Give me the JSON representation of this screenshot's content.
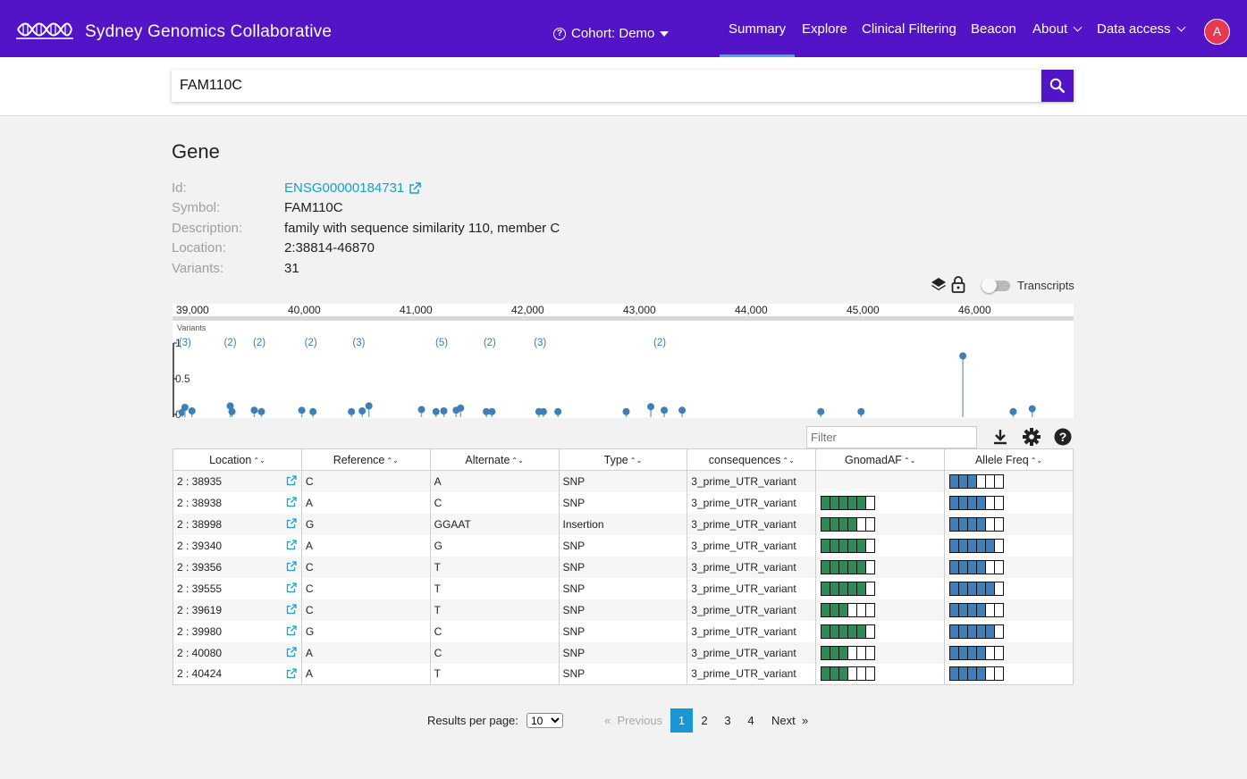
{
  "header": {
    "brand": "Sydney Genomics Collaborative",
    "cohort": "Cohort: Demo",
    "nav": [
      {
        "label": "Summary",
        "active": true
      },
      {
        "label": "Explore"
      },
      {
        "label": "Clinical Filtering"
      },
      {
        "label": "Beacon"
      },
      {
        "label": "About",
        "dropdown": true
      },
      {
        "label": "Data access",
        "dropdown": true
      }
    ],
    "avatar_letter": "A",
    "bg_color": "#5314c8"
  },
  "search": {
    "value": "FAM110C",
    "icon": "search-icon"
  },
  "gene": {
    "title": "Gene",
    "fields": [
      {
        "label": "Id:",
        "value": "ENSG00000184731",
        "link": true
      },
      {
        "label": "Symbol:",
        "value": "FAM110C"
      },
      {
        "label": "Description:",
        "value": "family with sequence similarity 110, member C"
      },
      {
        "label": "Location:",
        "value": "2:38814-46870"
      },
      {
        "label": "Variants:",
        "value": "31"
      }
    ]
  },
  "track": {
    "transcripts_label": "Transcripts",
    "transcripts_on": false,
    "panel_label": "Variants",
    "axis_ticks": [
      "39,000",
      "40,000",
      "41,000",
      "42,000",
      "43,000",
      "44,000",
      "45,000",
      "46,000"
    ],
    "y_ticks": [
      "1",
      "0.5",
      "0"
    ],
    "clusters": [
      {
        "label": "(3)",
        "pos": 38935
      },
      {
        "label": "(2)",
        "pos": 39340
      },
      {
        "label": "(2)",
        "pos": 39600
      },
      {
        "label": "(2)",
        "pos": 40060
      },
      {
        "label": "(3)",
        "pos": 40490
      },
      {
        "label": "(5)",
        "pos": 41230
      },
      {
        "label": "(2)",
        "pos": 41660
      },
      {
        "label": "(3)",
        "pos": 42110
      },
      {
        "label": "(2)",
        "pos": 43180
      }
    ],
    "lollipops": [
      {
        "pos": 38910,
        "af": 0.03
      },
      {
        "pos": 38935,
        "af": 0.1
      },
      {
        "pos": 38998,
        "af": 0.05
      },
      {
        "pos": 39340,
        "af": 0.12
      },
      {
        "pos": 39356,
        "af": 0.04
      },
      {
        "pos": 39555,
        "af": 0.06
      },
      {
        "pos": 39619,
        "af": 0.04
      },
      {
        "pos": 39980,
        "af": 0.06
      },
      {
        "pos": 40080,
        "af": 0.04
      },
      {
        "pos": 40424,
        "af": 0.04
      },
      {
        "pos": 40520,
        "af": 0.05
      },
      {
        "pos": 40580,
        "af": 0.12
      },
      {
        "pos": 41050,
        "af": 0.07
      },
      {
        "pos": 41180,
        "af": 0.04
      },
      {
        "pos": 41250,
        "af": 0.05
      },
      {
        "pos": 41360,
        "af": 0.06
      },
      {
        "pos": 41400,
        "af": 0.09
      },
      {
        "pos": 41630,
        "af": 0.04
      },
      {
        "pos": 41680,
        "af": 0.04
      },
      {
        "pos": 42100,
        "af": 0.04
      },
      {
        "pos": 42140,
        "af": 0.04
      },
      {
        "pos": 42270,
        "af": 0.04
      },
      {
        "pos": 42880,
        "af": 0.04
      },
      {
        "pos": 43100,
        "af": 0.11
      },
      {
        "pos": 43220,
        "af": 0.06
      },
      {
        "pos": 43380,
        "af": 0.06
      },
      {
        "pos": 44620,
        "af": 0.04
      },
      {
        "pos": 44980,
        "af": 0.04
      },
      {
        "pos": 45890,
        "af": 0.82
      },
      {
        "pos": 46340,
        "af": 0.04
      },
      {
        "pos": 46510,
        "af": 0.08
      }
    ]
  },
  "table": {
    "filter_placeholder": "Filter",
    "columns": [
      "Location",
      "Reference",
      "Alternate",
      "Type",
      "consequences",
      "GnomadAF",
      "Allele Freq"
    ],
    "rows": [
      {
        "location": "2 : 38935",
        "ref": "C",
        "alt": "A",
        "type": "SNP",
        "consequence": "3_prime_UTR_variant",
        "gnomad": 0,
        "allele": 3
      },
      {
        "location": "2 : 38938",
        "ref": "A",
        "alt": "C",
        "type": "SNP",
        "consequence": "3_prime_UTR_variant",
        "gnomad": 5,
        "allele": 4
      },
      {
        "location": "2 : 38998",
        "ref": "G",
        "alt": "GGAAT",
        "type": "Insertion",
        "consequence": "3_prime_UTR_variant",
        "gnomad": 4,
        "allele": 4
      },
      {
        "location": "2 : 39340",
        "ref": "A",
        "alt": "G",
        "type": "SNP",
        "consequence": "3_prime_UTR_variant",
        "gnomad": 5,
        "allele": 5
      },
      {
        "location": "2 : 39356",
        "ref": "C",
        "alt": "T",
        "type": "SNP",
        "consequence": "3_prime_UTR_variant",
        "gnomad": 5,
        "allele": 4
      },
      {
        "location": "2 : 39555",
        "ref": "C",
        "alt": "T",
        "type": "SNP",
        "consequence": "3_prime_UTR_variant",
        "gnomad": 5,
        "allele": 5
      },
      {
        "location": "2 : 39619",
        "ref": "C",
        "alt": "T",
        "type": "SNP",
        "consequence": "3_prime_UTR_variant",
        "gnomad": 3,
        "allele": 4
      },
      {
        "location": "2 : 39980",
        "ref": "G",
        "alt": "C",
        "type": "SNP",
        "consequence": "3_prime_UTR_variant",
        "gnomad": 5,
        "allele": 5
      },
      {
        "location": "2 : 40080",
        "ref": "A",
        "alt": "C",
        "type": "SNP",
        "consequence": "3_prime_UTR_variant",
        "gnomad": 3,
        "allele": 4
      },
      {
        "location": "2 : 40424",
        "ref": "A",
        "alt": "T",
        "type": "SNP",
        "consequence": "3_prime_UTR_variant",
        "gnomad": 3,
        "allele": 4
      }
    ],
    "gnomad_color": "#2e8b57",
    "allele_color": "#3d7fb8",
    "link_color": "#17a2c8"
  },
  "pagination": {
    "rpp_label": "Results per page:",
    "rpp_value": "10",
    "prev_label": "Previous",
    "next_label": "Next",
    "pages": [
      "1",
      "2",
      "3",
      "4"
    ],
    "current": "1"
  }
}
